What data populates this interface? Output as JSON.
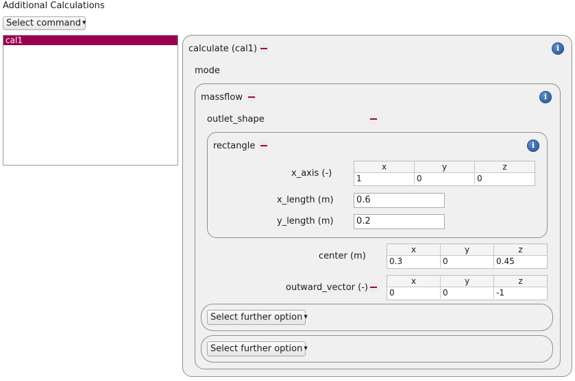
{
  "header": {
    "title": "Additional Calculations"
  },
  "toolbar": {
    "select_command": "Select command"
  },
  "calc_list": {
    "items": [
      "cal1"
    ]
  },
  "calculate": {
    "title": "calculate (cal1)",
    "mode_label": "mode",
    "massflow": {
      "title": "massflow",
      "outlet_shape_label": "outlet_shape",
      "rectangle": {
        "title": "rectangle",
        "x_axis": {
          "label": "x_axis (-)",
          "headers": [
            "x",
            "y",
            "z"
          ],
          "values": [
            "1",
            "0",
            "0"
          ]
        },
        "x_length": {
          "label": "x_length (m)",
          "value": "0.6"
        },
        "y_length": {
          "label": "y_length (m)",
          "value": "0.2"
        }
      },
      "center": {
        "label": "center (m)",
        "headers": [
          "x",
          "y",
          "z"
        ],
        "values": [
          "0.3",
          "0",
          "0.45"
        ]
      },
      "outward_vector": {
        "label": "outward_vector (-)",
        "headers": [
          "x",
          "y",
          "z"
        ],
        "values": [
          "0",
          "0",
          "-1"
        ]
      },
      "further_option_1": "Select further option",
      "further_option_2": "Select further option"
    }
  },
  "icons": {
    "info": "info-icon",
    "minus": "minus-icon",
    "caret": "chevron-down-icon"
  },
  "colors": {
    "accent": "#990050",
    "minus": "#a0003c",
    "info": "#1e4f97"
  }
}
